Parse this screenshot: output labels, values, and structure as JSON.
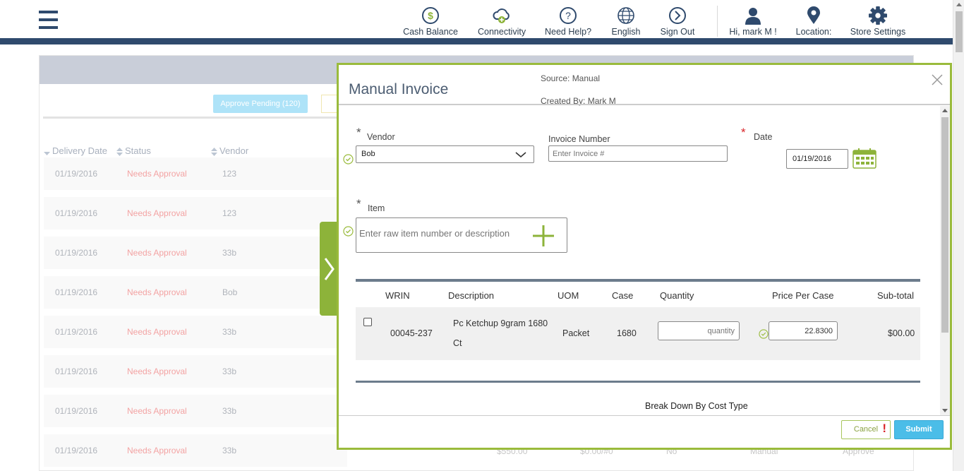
{
  "header": {
    "nav": [
      {
        "label": "Cash Balance",
        "icon": "dollar-icon"
      },
      {
        "label": "Connectivity",
        "icon": "cloud-plus-icon"
      },
      {
        "label": "Need Help?",
        "icon": "question-icon"
      },
      {
        "label": "English",
        "icon": "globe-icon"
      },
      {
        "label": "Sign Out",
        "icon": "chevron-circle-icon"
      },
      {
        "label": "Hi,  mark M !",
        "icon": "user-icon"
      },
      {
        "label": "Location:",
        "icon": "location-pin-icon"
      },
      {
        "label": "Store Settings",
        "icon": "gear-icon"
      }
    ],
    "colors": {
      "nav_dark": "#2f4a6d",
      "accent_green": "#9abb3c"
    }
  },
  "background_list": {
    "approve_button": "Approve Pending (120)",
    "columns": [
      "Delivery Date",
      "Status",
      "Vendor"
    ],
    "rows": [
      {
        "date": "01/19/2016",
        "status": "Needs Approval",
        "vendor": "123"
      },
      {
        "date": "01/19/2016",
        "status": "Needs Approval",
        "vendor": "123"
      },
      {
        "date": "01/19/2016",
        "status": "Needs Approval",
        "vendor": "33b"
      },
      {
        "date": "01/19/2016",
        "status": "Needs Approval",
        "vendor": "Bob"
      },
      {
        "date": "01/19/2016",
        "status": "Needs Approval",
        "vendor": "33b"
      },
      {
        "date": "01/19/2016",
        "status": "Needs Approval",
        "vendor": "33b"
      },
      {
        "date": "01/19/2016",
        "status": "Needs Approval",
        "vendor": "33b"
      },
      {
        "date": "01/19/2016",
        "status": "Needs Approval",
        "vendor": "33b"
      }
    ],
    "bottom_row_extra": [
      "$550.00",
      "$0.00/#0",
      "No",
      "Manual",
      "Approve"
    ]
  },
  "modal": {
    "title": "Manual Invoice",
    "source": "Source: Manual",
    "created_by": "Created By: Mark M",
    "vendor": {
      "label": "Vendor",
      "value": "Bob"
    },
    "invoice_number": {
      "label": "Invoice Number",
      "placeholder": "Enter Invoice #"
    },
    "date": {
      "label": "Date",
      "value": "01/19/2016"
    },
    "item": {
      "label": "Item",
      "placeholder": "Enter raw item number or description"
    },
    "table": {
      "headers": [
        "WRIN",
        "Description",
        "UOM",
        "Case",
        "Quantity",
        "Price Per Case",
        "Sub-total"
      ],
      "rows": [
        {
          "wrin": "00045-237",
          "description_line1": "Pc Ketchup 9gram 1680",
          "description_line2": "Ct",
          "uom": "Packet",
          "case": "1680",
          "quantity_placeholder": "quantity",
          "price": "22.8300",
          "subtotal": "$00.00"
        }
      ]
    },
    "breakdown_title": "Break Down By Cost Type",
    "cancel_label": "Cancel",
    "cancel_flag": "!",
    "submit_label": "Submit"
  }
}
